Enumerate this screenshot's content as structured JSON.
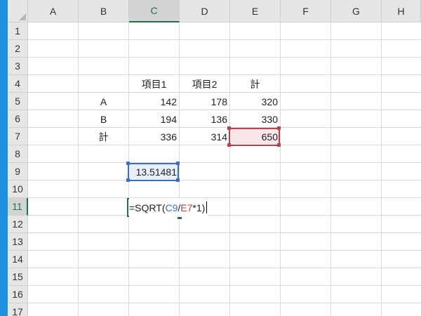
{
  "columns": [
    "A",
    "B",
    "C",
    "D",
    "E",
    "F",
    "G",
    "H"
  ],
  "rows": [
    "1",
    "2",
    "3",
    "4",
    "5",
    "6",
    "7",
    "8",
    "9",
    "10",
    "11",
    "12",
    "13",
    "14",
    "15",
    "16",
    "17"
  ],
  "active_column": "C",
  "active_row": "11",
  "cells": {
    "C4": "項目1",
    "D4": "項目2",
    "E4": "計",
    "B5": "A",
    "C5": "142",
    "D5": "178",
    "E5": "320",
    "B6": "B",
    "C6": "194",
    "D6": "136",
    "E6": "330",
    "B7": "計",
    "C7": "336",
    "D7": "314",
    "E7": "650",
    "C9": "13.51481"
  },
  "formula": {
    "prefix": "=SQRT(",
    "ref1": "C9",
    "sep": "/",
    "ref2": "E7",
    "suffix": "*1)"
  },
  "colors": {
    "accent_green": "#217346",
    "ref_blue": "#3d6fba",
    "ref_red": "#b04452",
    "window_edge": "#1d8fe1"
  }
}
